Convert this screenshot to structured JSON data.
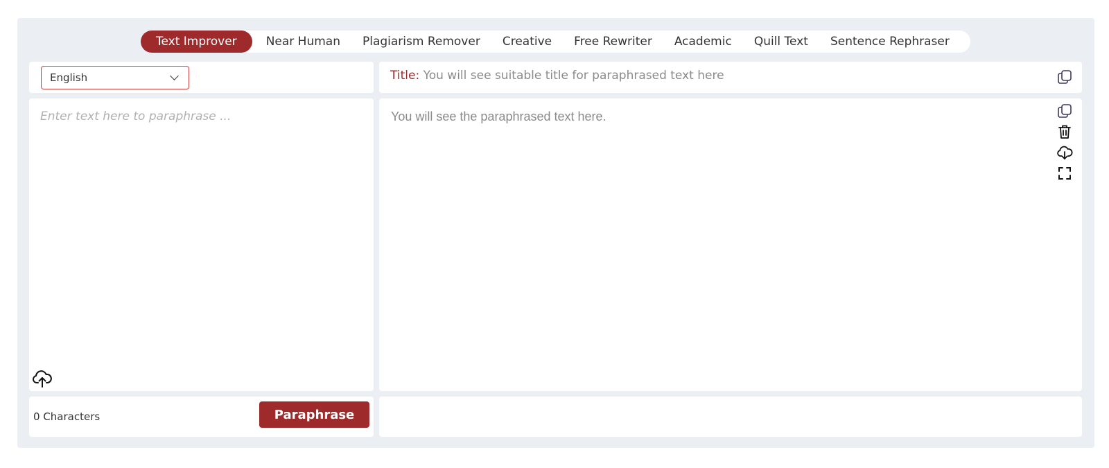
{
  "tabs": [
    {
      "label": "Text Improver",
      "active": true
    },
    {
      "label": "Near Human",
      "active": false
    },
    {
      "label": "Plagiarism Remover",
      "active": false
    },
    {
      "label": "Creative",
      "active": false
    },
    {
      "label": "Free Rewriter",
      "active": false
    },
    {
      "label": "Academic",
      "active": false
    },
    {
      "label": "Quill Text",
      "active": false
    },
    {
      "label": "Sentence Rephraser",
      "active": false
    }
  ],
  "language": {
    "selected": "English"
  },
  "title_panel": {
    "label": "Title",
    "separator": ":",
    "placeholder": "You will see suitable title for paraphrased text here"
  },
  "input": {
    "placeholder": "Enter text here to paraphrase ..."
  },
  "output": {
    "placeholder": "You will see the paraphrased text here."
  },
  "footer": {
    "char_count": "0 Characters",
    "paraphrase_label": "Paraphrase"
  },
  "colors": {
    "accent": "#9e2a2b",
    "frame_bg": "#ebeff3"
  },
  "icons": [
    "copy-icon",
    "copy-icon",
    "trash-icon",
    "cloud-download-icon",
    "fullscreen-icon",
    "cloud-upload-icon",
    "chevron-down-icon"
  ]
}
